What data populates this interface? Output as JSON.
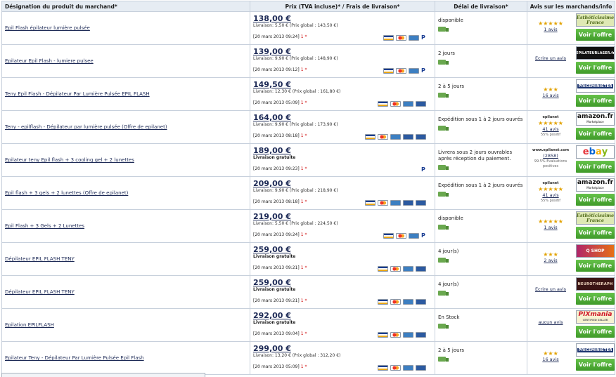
{
  "headers": {
    "name": "Désignation du produit du marchand*",
    "price": "Prix (TVA incluse)* / Frais de livraison*",
    "delay": "Délai de livraison*",
    "reviews": "Avis sur les marchands/info"
  },
  "offer_label": "Voir l'offre",
  "one_marker": "1",
  "rows": [
    {
      "name": "Epil Flash épilateur lumière pulsée",
      "price": "138,00 €",
      "shipping": "Livraison: 5,50 € (Prix global : 143,50 €)",
      "date": "[20 mars 2013 09:24]",
      "cards": [
        "visa",
        "mc",
        "amex",
        "pp"
      ],
      "delay": "disponible",
      "stars": "★★★★★",
      "review": "1 avis",
      "review_note": "",
      "logo": "Esthéticissime France",
      "logo_style": "esth"
    },
    {
      "name": "Epilateur Epil Flash - lumiere pulsee",
      "price": "139,00 €",
      "shipping": "Livraison: 9,90 € (Prix global : 148,90 €)",
      "date": "[20 mars 2013 09:12]",
      "cards": [
        "visa",
        "mc",
        "amex",
        "pp"
      ],
      "delay": "2 jours",
      "stars": "",
      "review": "Ecrire un avis",
      "review_note": "",
      "logo": "EPILATEURLASER.fr",
      "logo_style": "epil"
    },
    {
      "name": "Teny Epil Flash - Dépilateur Par Lumière Pulsée EPIL FLASH",
      "price": "149,50 €",
      "shipping": "Livraison: 12,30 € (Prix global : 161,80 €)",
      "date": "[20 mars 2013 05:09]",
      "cards": [
        "visa",
        "mc",
        "amex",
        "cb"
      ],
      "delay": "2 à 5 jours",
      "stars": "★★★",
      "review": "16 avis",
      "review_note": "",
      "logo": "PRICEMINISTER",
      "logo_style": "price"
    },
    {
      "name": "Teny - epilflash - Dépilateur par lumière pulsée (Offre de epilanet)",
      "price": "164,00 €",
      "shipping": "Livraison: 9,90 € (Prix global : 173,90 €)",
      "date": "[20 mars 2013 08:18]",
      "cards": [
        "visa",
        "mc",
        "amex",
        "cb",
        "cb"
      ],
      "delay": "Expédition sous 1 à 2 jours ouvrés",
      "stars": "★★★★★",
      "review": "41 avis",
      "review_note": "55% positif",
      "review_head": "epilanet",
      "logo": "amazon.fr",
      "logo_style": "amz",
      "logo_sub": "Marketplace"
    },
    {
      "name": "Epilateur teny Epil flash + 3 cooling gel + 2 lunettes",
      "price": "189,00 €",
      "shipping": "Livraison gratuite",
      "date": "[20 mars 2013 09:23]",
      "cards": [
        "pp"
      ],
      "delay": "Livrera sous 2 jours ouvrables après réception du paiement.",
      "stars": "",
      "review": "(2858)",
      "review_note": "99.5% Evaluations positives",
      "review_head": "www.epilanet.com",
      "logo": "ebay",
      "logo_style": "ebay"
    },
    {
      "name": "Epil flash + 3 gels + 2 lunettes (Offre de epilanet)",
      "price": "209,00 €",
      "shipping": "Livraison: 9,90 € (Prix global : 218,90 €)",
      "date": "[20 mars 2013 08:18]",
      "cards": [
        "visa",
        "mc",
        "amex",
        "cb",
        "cb"
      ],
      "delay": "Expédition sous 1 à 2 jours ouvrés",
      "stars": "★★★★★",
      "review": "41 avis",
      "review_note": "55% positif",
      "review_head": "epilanet",
      "logo": "amazon.fr",
      "logo_style": "amz",
      "logo_sub": "Marketplace"
    },
    {
      "name": "Epil Flash + 3 Gels + 2 Lunettes",
      "price": "219,00 €",
      "shipping": "Livraison: 5,50 € (Prix global : 224,50 €)",
      "date": "[20 mars 2013 09:24]",
      "cards": [
        "visa",
        "mc",
        "amex",
        "pp"
      ],
      "delay": "disponible",
      "stars": "★★★★★",
      "review": "1 avis",
      "review_note": "",
      "logo": "Esthéticissime France",
      "logo_style": "esth"
    },
    {
      "name": "Dépilateur EPIL FLASH TENY",
      "price": "259,00 €",
      "shipping": "Livraison gratuite",
      "date": "[20 mars 2013 09:21]",
      "cards": [
        "visa",
        "mc",
        "amex",
        "cb"
      ],
      "delay": "4 jour(s)",
      "stars": "★★★",
      "review": "2 avis",
      "review_note": "",
      "logo": "Q SHOP",
      "logo_style": "qs"
    },
    {
      "name": "Dépilateur EPIL FLASH TENY",
      "price": "259,00 €",
      "shipping": "Livraison gratuite",
      "date": "[20 mars 2013 09:21]",
      "cards": [
        "visa",
        "mc",
        "amex",
        "cb"
      ],
      "delay": "4 jour(s)",
      "stars": "",
      "review": "Ecrire un avis",
      "review_note": "",
      "logo": "NEUROTHERAPH",
      "logo_style": "neuro"
    },
    {
      "name": "Epilation EPILFLASH",
      "price": "292,00 €",
      "shipping": "Livraison gratuite",
      "date": "[20 mars 2013 09:04]",
      "cards": [
        "visa",
        "mc",
        "amex",
        "cb"
      ],
      "delay": "En Stock",
      "stars": "",
      "review": "aucun avis",
      "review_note": "",
      "logo": "PIXmania",
      "logo_style": "pix",
      "logo_sub": "CERTIFIED SELLER"
    },
    {
      "name": "Epilateur Teny - Dépilateur Par Lumière Pulsée Epil Flash",
      "price": "299,00 €",
      "shipping": "Livraison: 13,20 € (Prix global : 312,20 €)",
      "date": "[20 mars 2013 05:09]",
      "cards": [
        "visa",
        "mc",
        "amex",
        "cb"
      ],
      "delay": "2 à 5 jours",
      "stars": "★★★",
      "review": "16 avis",
      "review_note": "",
      "logo": "PRICEMINISTER",
      "logo_style": "price"
    }
  ]
}
